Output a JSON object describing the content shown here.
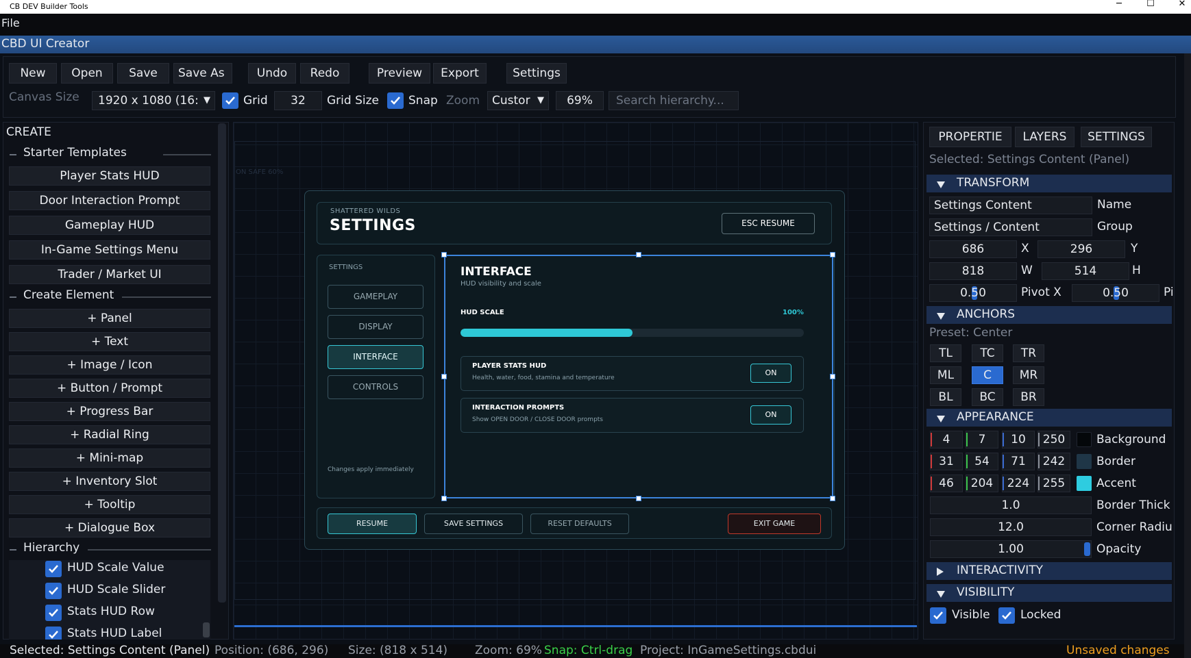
{
  "window": {
    "title": "CB DEV Builder Tools",
    "minimize": "─",
    "maximize": "☐",
    "close": "✕"
  },
  "menu": {
    "file": "File"
  },
  "app": {
    "header": "CBD UI Creator"
  },
  "toolbar": {
    "new": "New",
    "open": "Open",
    "save": "Save",
    "save_as": "Save As",
    "undo": "Undo",
    "redo": "Redo",
    "preview": "Preview",
    "export": "Export",
    "settings": "Settings",
    "canvas_size_label": "Canvas Size",
    "canvas_size_value": "1920 x 1080 (16:",
    "grid_label": "Grid",
    "grid_checked": true,
    "grid_size_value": "32",
    "grid_size_label": "Grid Size",
    "snap_label": "Snap",
    "snap_checked": true,
    "zoom_label": "Zoom",
    "zoom_mode": "Custor",
    "zoom_value": "69%",
    "search_placeholder": "Search hierarchy..."
  },
  "left": {
    "create_title": "CREATE",
    "starter_templates": "Starter Templates",
    "templates": [
      "Player Stats HUD",
      "Door Interaction Prompt",
      "Gameplay HUD",
      "In-Game Settings Menu",
      "Trader / Market UI"
    ],
    "create_element": "Create Element",
    "elements": [
      "+ Panel",
      "+ Text",
      "+ Image / Icon",
      "+ Button / Prompt",
      "+ Progress Bar",
      "+ Radial Ring",
      "+ Mini-map",
      "+ Inventory Slot",
      "+ Tooltip",
      "+ Dialogue Box"
    ],
    "hierarchy": "Hierarchy",
    "hierarchy_items": [
      "HUD Scale Value",
      "HUD Scale Slider",
      "Stats HUD Row",
      "Stats HUD Label"
    ]
  },
  "canvas": {
    "safe_label": "ON SAFE 60%",
    "preview": {
      "subtitle": "SHATTERED WILDS",
      "title": "SETTINGS",
      "esc": "ESC  RESUME",
      "nav_label": "SETTINGS",
      "nav": [
        "GAMEPLAY",
        "DISPLAY",
        "INTERFACE",
        "CONTROLS"
      ],
      "nav_active": 2,
      "nav_note": "Changes apply immediately",
      "content_title": "INTERFACE",
      "content_sub": "HUD visibility and scale",
      "hud_scale_label": "HUD SCALE",
      "hud_scale_value": "100%",
      "hud_scale_fill": 0.5,
      "rows": [
        {
          "title": "PLAYER STATS HUD",
          "sub": "Health, water, food, stamina and temperature",
          "state": "ON"
        },
        {
          "title": "INTERACTION PROMPTS",
          "sub": "Show OPEN DOOR / CLOSE DOOR prompts",
          "state": "ON"
        }
      ],
      "buttons": {
        "resume": "RESUME",
        "save": "SAVE SETTINGS",
        "reset": "RESET DEFAULTS",
        "exit": "EXIT GAME"
      }
    }
  },
  "right": {
    "tabs": [
      "PROPERTIE",
      "LAYERS",
      "SETTINGS"
    ],
    "selected": "Selected: Settings Content (Panel)",
    "transform": {
      "title": "TRANSFORM",
      "name_value": "Settings Content",
      "name_label": "Name",
      "group_value": "Settings / Content",
      "group_label": "Group",
      "x_value": "686",
      "x_label": "X",
      "y_value": "296",
      "y_label": "Y",
      "w_value": "818",
      "w_label": "W",
      "h_value": "514",
      "h_label": "H",
      "pivot_x_value": "0.50",
      "pivot_x_label": "Pivot X",
      "pivot_y_value": "0.50",
      "pivot_y_label": "Pi"
    },
    "anchors": {
      "title": "ANCHORS",
      "preset": "Preset: Center",
      "grid": [
        "TL",
        "TC",
        "TR",
        "ML",
        "C",
        "MR",
        "BL",
        "BC",
        "BR"
      ],
      "active": "C"
    },
    "appearance": {
      "title": "APPEARANCE",
      "background": {
        "label": "Background",
        "r": "4",
        "g": "7",
        "b": "10",
        "a": "250",
        "color": "#04070a"
      },
      "border": {
        "label": "Border",
        "r": "31",
        "g": "54",
        "b": "71",
        "a": "242",
        "color": "#1f3647"
      },
      "accent": {
        "label": "Accent",
        "r": "46",
        "g": "204",
        "b": "224",
        "a": "255",
        "color": "#2ecce0"
      },
      "border_thickness_value": "1.0",
      "border_thickness_label": "Border Thick",
      "corner_radius_value": "12.0",
      "corner_radius_label": "Corner Radiu",
      "opacity_value": "1.00",
      "opacity_label": "Opacity"
    },
    "interactivity": {
      "title": "INTERACTIVITY"
    },
    "visibility": {
      "title": "VISIBILITY",
      "visible": "Visible",
      "locked": "Locked"
    }
  },
  "status": {
    "selected": "Selected: Settings Content (Panel)",
    "position": "Position: (686, 296)",
    "size": "Size: (818 x 514)",
    "zoom": "Zoom: 69%",
    "snap": "Snap: Ctrl-drag",
    "project": "Project: InGameSettings.cbdui",
    "unsaved": "Unsaved changes"
  }
}
